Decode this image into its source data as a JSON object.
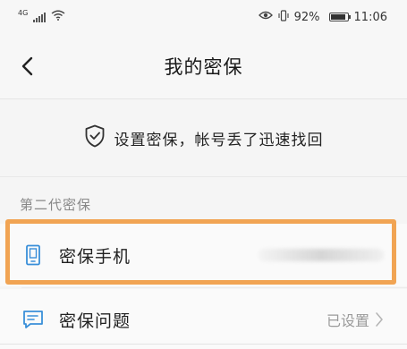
{
  "status_bar": {
    "network_type": "4G",
    "battery_percent": "92%",
    "battery_level": 0.92,
    "time": "11:06",
    "icons": [
      "signal-icon",
      "wifi-icon",
      "eye-icon",
      "vibrate-icon",
      "battery-icon"
    ]
  },
  "header": {
    "title": "我的密保",
    "back_icon": "chevron-left-icon"
  },
  "banner": {
    "icon": "shield-check-icon",
    "text": "设置密保，帐号丢了迅速找回"
  },
  "section": {
    "title": "第二代密保"
  },
  "rows": [
    {
      "label": "密保手机",
      "icon": "phone-icon",
      "value": ""
    },
    {
      "label": "密保问题",
      "icon": "chat-icon",
      "value": "已设置"
    }
  ],
  "colors": {
    "accent": "#3a8fd9",
    "highlight": "#f1a453",
    "background": "#f5f5f5"
  }
}
